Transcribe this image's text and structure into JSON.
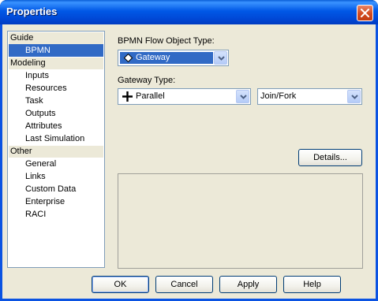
{
  "window": {
    "title": "Properties"
  },
  "sidebar": {
    "groups": [
      {
        "header": "Guide",
        "items": [
          {
            "label": "BPMN",
            "selected": true
          }
        ]
      },
      {
        "header": "Modeling",
        "items": [
          {
            "label": "Inputs"
          },
          {
            "label": "Resources"
          },
          {
            "label": "Task"
          },
          {
            "label": "Outputs"
          },
          {
            "label": "Attributes"
          },
          {
            "label": "Last Simulation"
          }
        ]
      },
      {
        "header": "Other",
        "items": [
          {
            "label": "General"
          },
          {
            "label": "Links"
          },
          {
            "label": "Custom Data"
          },
          {
            "label": "Enterprise"
          },
          {
            "label": "RACI"
          }
        ]
      }
    ]
  },
  "main": {
    "flow_object_label": "BPMN Flow Object Type:",
    "flow_object_value": "Gateway",
    "flow_object_icon": "diamond-icon",
    "gateway_type_label": "Gateway Type:",
    "gateway_type_value": "Parallel",
    "gateway_type_icon": "plus-icon",
    "gateway_mode_value": "Join/Fork",
    "details_button": "Details..."
  },
  "footer": {
    "ok": "OK",
    "cancel": "Cancel",
    "apply": "Apply",
    "help": "Help"
  },
  "colors": {
    "titlebar": "#0058e6",
    "selection": "#316ac5",
    "dialog_bg": "#ece9d8",
    "close_button": "#d24a1f"
  }
}
